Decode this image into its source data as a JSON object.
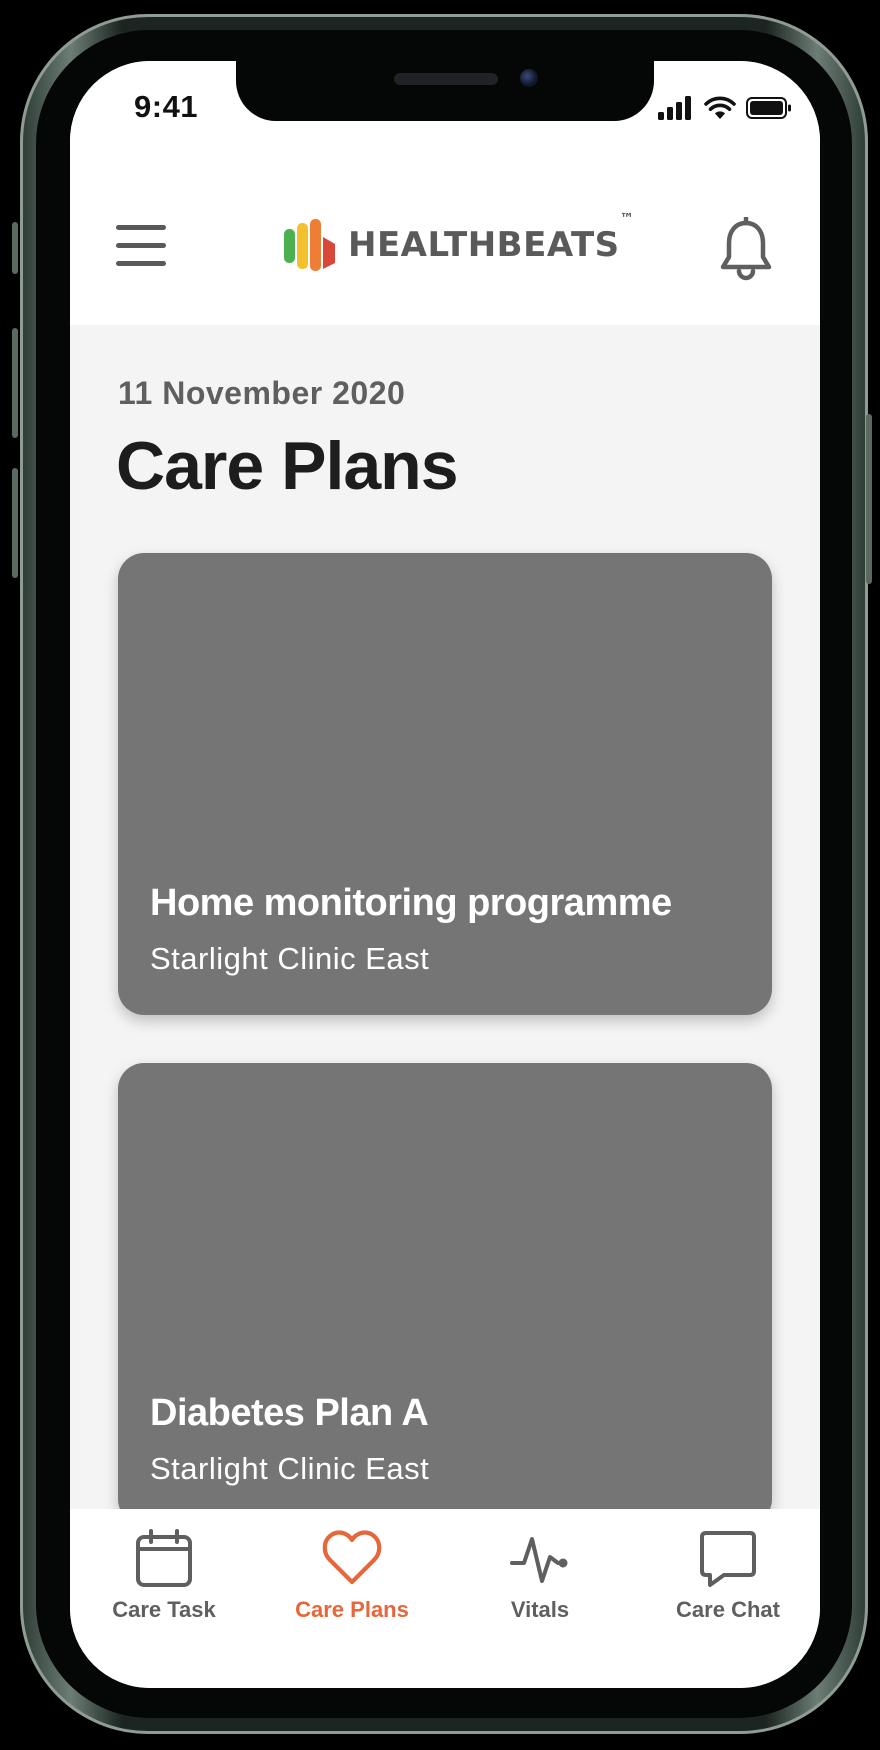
{
  "status_bar": {
    "time": "9:41"
  },
  "header": {
    "brand": "HEALTHBEATS",
    "trademark": "™"
  },
  "page": {
    "date": "11 November 2020",
    "title": "Care Plans"
  },
  "care_plans": [
    {
      "name": "Home monitoring programme",
      "clinic": "Starlight Clinic East"
    },
    {
      "name": "Diabetes Plan A",
      "clinic": "Starlight Clinic East"
    }
  ],
  "tab_bar": {
    "tabs": [
      {
        "label": "Care Task",
        "icon": "calendar-icon",
        "active": false
      },
      {
        "label": "Care Plans",
        "icon": "heart-icon",
        "active": true
      },
      {
        "label": "Vitals",
        "icon": "pulse-icon",
        "active": false
      },
      {
        "label": "Care Chat",
        "icon": "chat-bubble-icon",
        "active": false
      }
    ]
  },
  "colors": {
    "accent": "#e5673a",
    "card": "#757575",
    "icon_gray": "#5f5f5f",
    "logo_green": "#4caf50",
    "logo_yellow": "#f4c12e",
    "logo_orange": "#ee7d35",
    "logo_red": "#d9463a"
  }
}
